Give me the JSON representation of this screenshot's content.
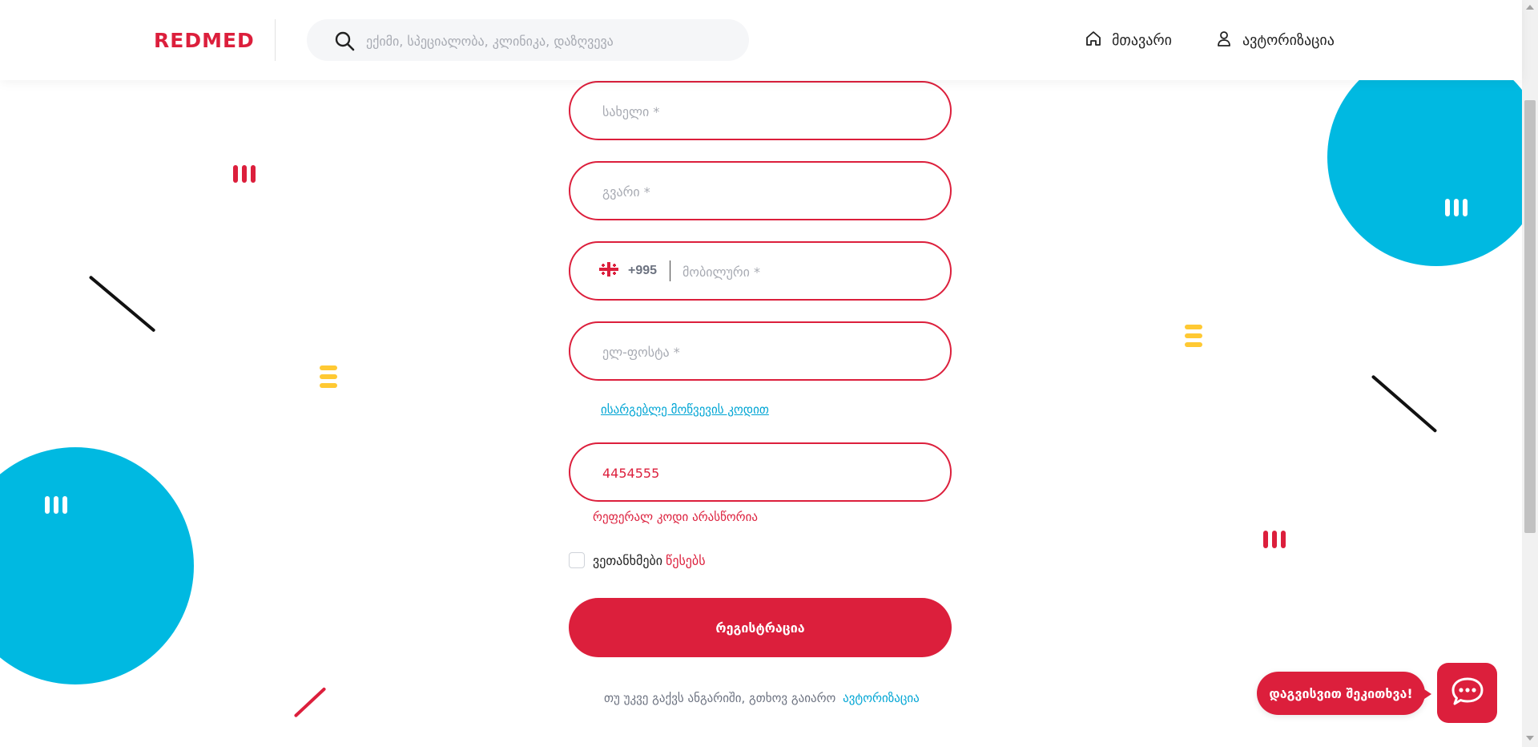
{
  "header": {
    "logo": "REDMED",
    "search_placeholder": "ექიმი, სპეციალობა, კლინიკა, დაზღვევა",
    "nav": {
      "home": "მთავარი",
      "auth": "ავტორიზაცია"
    }
  },
  "form": {
    "first_name_placeholder": "სახელი *",
    "last_name_placeholder": "გვარი *",
    "phone_code": "+995",
    "mobile_placeholder": "მობილური *",
    "email_placeholder": "ელ-ფოსტა *",
    "promo_link": "ისარგებლე მოწვევის კოდით",
    "referral_value": "4454555",
    "referral_error": "რეფერალ კოდი არასწორია",
    "terms_text": "ვეთანხმები",
    "terms_link": "წესებს",
    "submit_label": "რეგისტრაცია",
    "login_prompt": "თუ უკვე გაქვს ანგარიში, გთხოვ გაიარო",
    "login_link": "ავტორიზაცია"
  },
  "chat": {
    "bubble_text": "დაგვისვით შეკითხვა!"
  },
  "colors": {
    "brand_red": "#dc1f3c",
    "accent_blue": "#00b9e1",
    "accent_yellow": "#ffc933",
    "link_blue": "#00a5d4"
  }
}
